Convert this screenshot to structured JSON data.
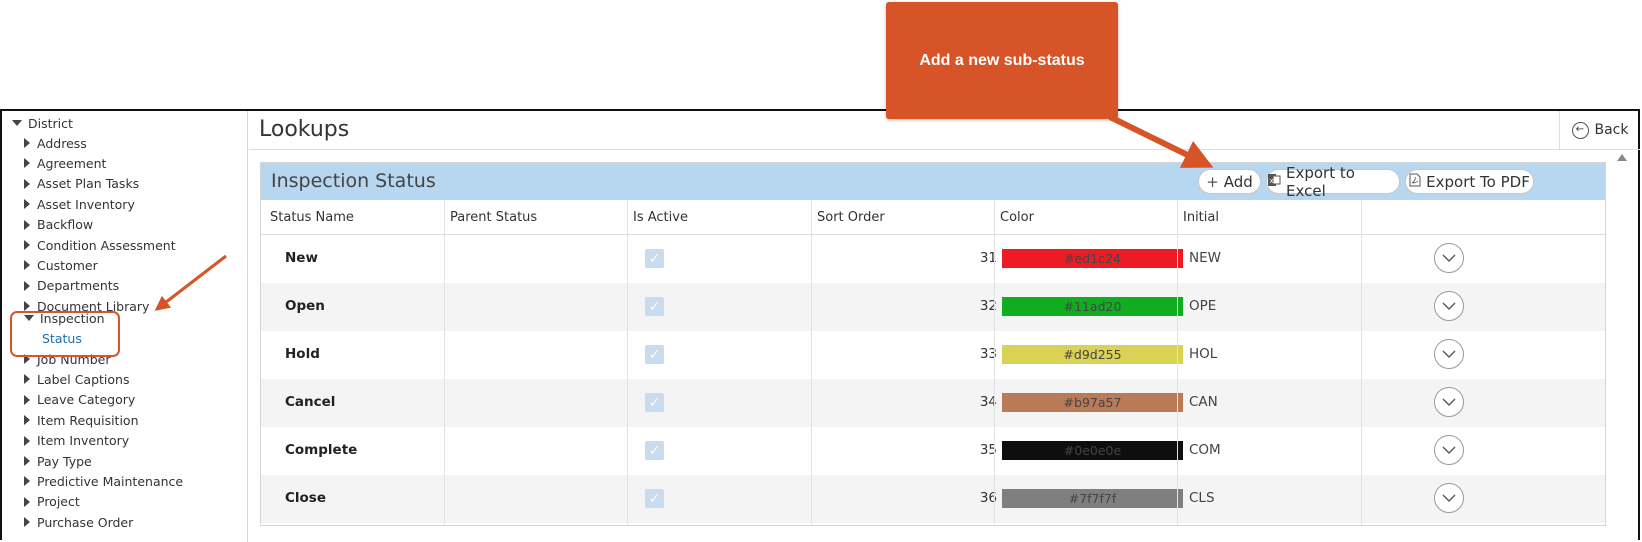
{
  "callout": {
    "text": "Add a new sub-status"
  },
  "sidebar": {
    "root": "District",
    "items_before": [
      "Address",
      "Agreement",
      "Asset Plan Tasks",
      "Asset Inventory",
      "Backflow",
      "Condition Assessment",
      "Customer",
      "Departments",
      "Document Library"
    ],
    "expanded": {
      "label": "Inspection",
      "child": "Status"
    },
    "items_after": [
      "Job Number",
      "Label Captions",
      "Leave Category",
      "Item Requisition",
      "Item Inventory",
      "Pay Type",
      "Predictive Maintenance",
      "Project",
      "Purchase Order"
    ]
  },
  "header": {
    "title": "Lookups",
    "back_label": "Back"
  },
  "panel": {
    "title": "Inspection Status",
    "add_label": "Add",
    "excel_label": "Export to Excel",
    "pdf_label": "Export To PDF"
  },
  "table": {
    "columns": [
      "Status Name",
      "Parent Status",
      "Is Active",
      "Sort Order",
      "Color",
      "Initial"
    ],
    "rows": [
      {
        "name": "New",
        "parent": "",
        "active": true,
        "sort": "31",
        "color": "#ed1c24",
        "initial": "NEW"
      },
      {
        "name": "Open",
        "parent": "",
        "active": true,
        "sort": "32",
        "color": "#11ad20",
        "initial": "OPE"
      },
      {
        "name": "Hold",
        "parent": "",
        "active": true,
        "sort": "33",
        "color": "#d9d255",
        "initial": "HOL"
      },
      {
        "name": "Cancel",
        "parent": "",
        "active": true,
        "sort": "34",
        "color": "#b97a57",
        "initial": "CAN"
      },
      {
        "name": "Complete",
        "parent": "",
        "active": true,
        "sort": "35",
        "color": "#0e0e0e",
        "initial": "COM"
      },
      {
        "name": "Close",
        "parent": "",
        "active": true,
        "sort": "36",
        "color": "#7f7f7f",
        "initial": "CLS"
      }
    ]
  },
  "colors": {
    "accent": "#d65427",
    "header_band": "#b7d6ef",
    "link": "#1a6fb3"
  }
}
